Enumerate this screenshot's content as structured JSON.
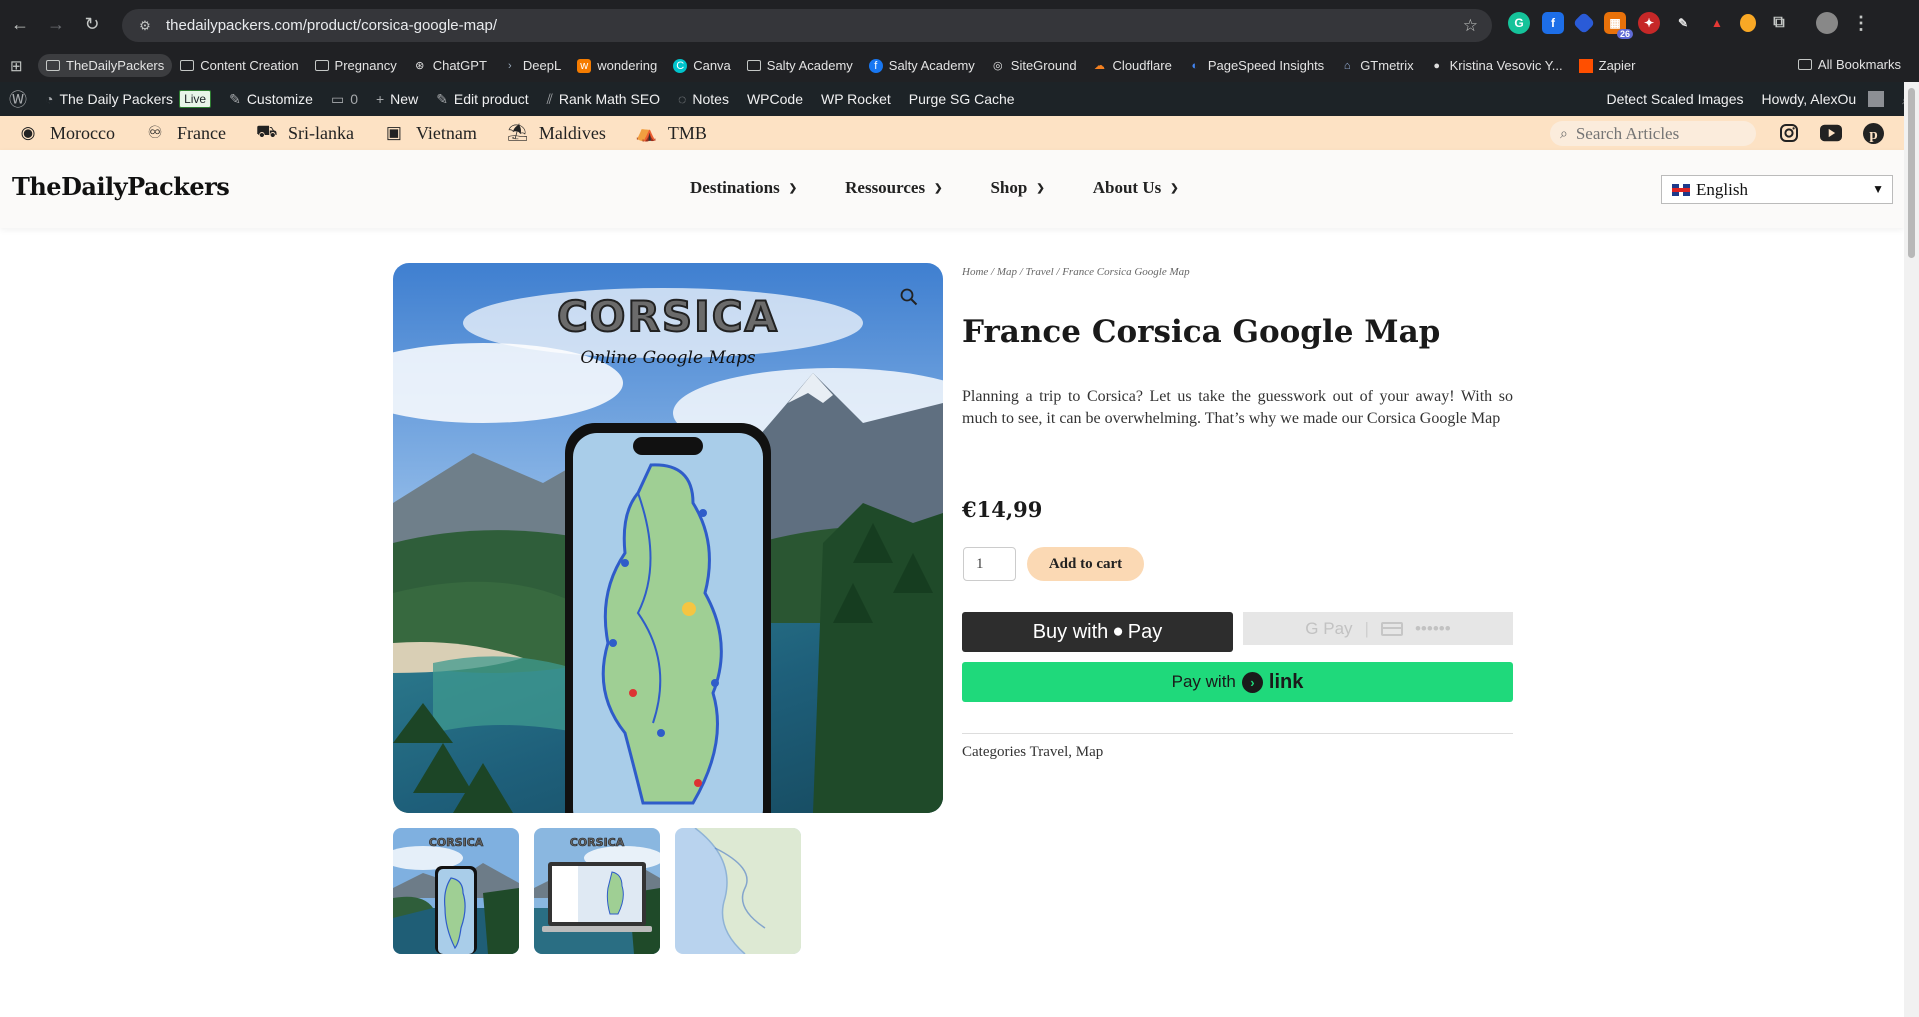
{
  "browser": {
    "url": "thedailypackers.com/product/corsica-google-map/",
    "extension_badge": "26"
  },
  "bookmarks": {
    "items": [
      {
        "label": "TheDailyPackers",
        "icon": "folder-icon"
      },
      {
        "label": "Content Creation",
        "icon": "folder-icon"
      },
      {
        "label": "Pregnancy",
        "icon": "folder-icon"
      },
      {
        "label": "ChatGPT",
        "icon": "chatgpt-icon"
      },
      {
        "label": "DeepL",
        "icon": "deepl-icon"
      },
      {
        "label": "wondering",
        "icon": "wondering-icon"
      },
      {
        "label": "Canva",
        "icon": "canva-icon"
      },
      {
        "label": "Salty Academy",
        "icon": "folder-icon"
      },
      {
        "label": "Salty Academy",
        "icon": "facebook-icon"
      },
      {
        "label": "SiteGround",
        "icon": "siteground-icon"
      },
      {
        "label": "Cloudflare",
        "icon": "cloudflare-icon"
      },
      {
        "label": "PageSpeed Insights",
        "icon": "pagespeed-icon"
      },
      {
        "label": "GTmetrix",
        "icon": "gtmetrix-icon"
      },
      {
        "label": "Kristina Vesovic Y...",
        "icon": "profile-icon"
      },
      {
        "label": "Zapier",
        "icon": "zapier-icon"
      }
    ],
    "all_bookmarks": "All Bookmarks"
  },
  "wpbar": {
    "site_name": "The Daily Packers",
    "live": "Live",
    "customize": "Customize",
    "comments": "0",
    "new": "New",
    "edit_product": "Edit product",
    "rank_math": "Rank Math SEO",
    "notes": "Notes",
    "wpcode": "WPCode",
    "wp_rocket": "WP Rocket",
    "purge": "Purge SG Cache",
    "detect": "Detect Scaled Images",
    "howdy": "Howdy, AlexOu"
  },
  "destinations": [
    {
      "label": "Morocco",
      "icon": "compass-icon"
    },
    {
      "label": "France",
      "icon": "binoculars-icon"
    },
    {
      "label": "Sri-lanka",
      "icon": "car-icon"
    },
    {
      "label": "Vietnam",
      "icon": "train-icon"
    },
    {
      "label": "Maldives",
      "icon": "umbrella-beach-icon"
    },
    {
      "label": "TMB",
      "icon": "campground-icon"
    }
  ],
  "search": {
    "placeholder": "Search Articles"
  },
  "header": {
    "logo": "TheDailyPackers",
    "nav": [
      "Destinations",
      "Ressources",
      "Shop",
      "About Us"
    ],
    "language": "English"
  },
  "product": {
    "breadcrumb": "Home / Map / Travel / France Corsica Google Map",
    "title": "France Corsica Google Map",
    "description": "Planning a trip to Corsica? Let us take the guesswork out of your away! With so much to see, it can be overwhelming. That’s why we made our Corsica Google Map",
    "price": "€14,99",
    "quantity": "1",
    "add_to_cart": "Add to cart",
    "apple_pay": "Buy with",
    "apple_pay_brand": "Pay",
    "gpay": "G Pay",
    "gpay_dots": "••••••",
    "link_pay": "Pay with",
    "link_brand": "link",
    "categories_label": "Categories",
    "categories": "Travel, Map",
    "image_title": "CORSICA",
    "image_subtitle": "Online Google Maps"
  }
}
